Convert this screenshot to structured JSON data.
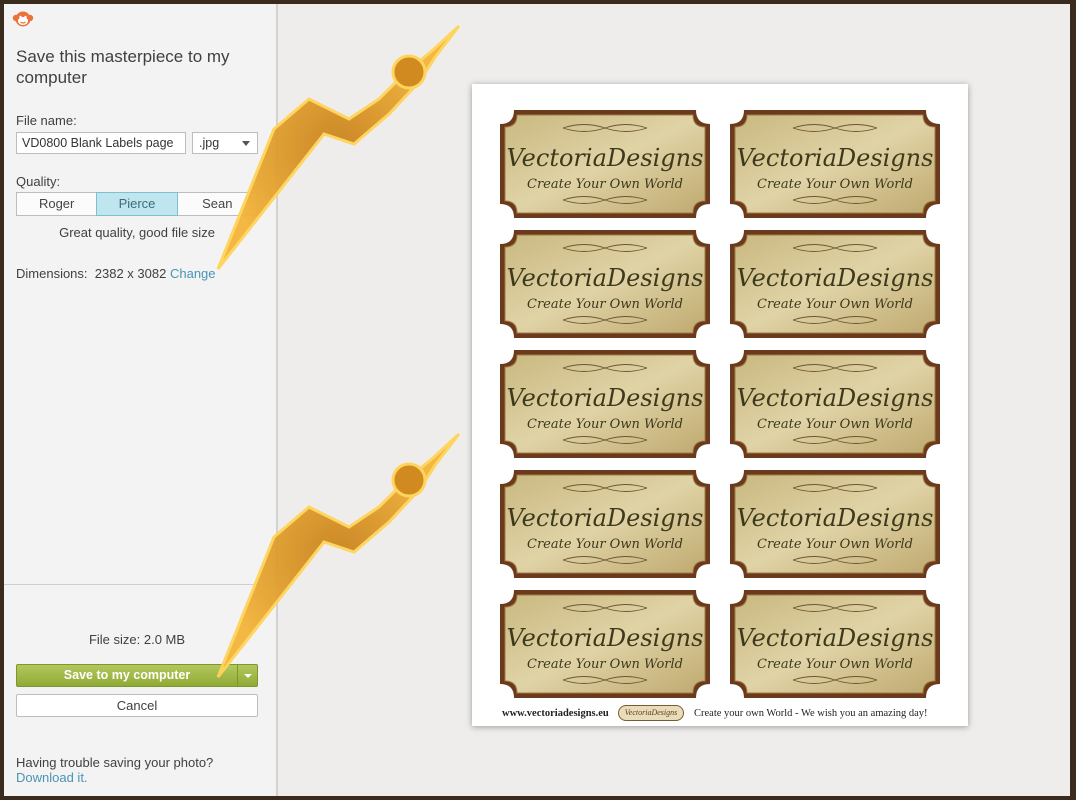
{
  "panel": {
    "title": "Save this masterpiece to my computer",
    "file_name_label": "File name:",
    "file_name_value": "VD0800 Blank Labels page",
    "format_value": ".jpg",
    "quality_label": "Quality:",
    "quality_options": [
      "Roger",
      "Pierce",
      "Sean"
    ],
    "quality_selected": "Pierce",
    "quality_description": "Great quality, good file size",
    "dimensions_label": "Dimensions:",
    "dimensions_value": "2382 x 3082",
    "change_link": "Change",
    "file_size": "File size: 2.0 MB",
    "save_button": "Save to my computer",
    "cancel_button": "Cancel",
    "trouble_text": "Having trouble saving your photo?",
    "download_link": "Download it."
  },
  "preview": {
    "label_brand": "VectoriaDesigns",
    "label_tagline": "Create Your Own World",
    "footer_url": "www.vectoriadesigns.eu",
    "footer_logo_text": "VectoriaDesigns",
    "footer_tagline": "Create your own World - We wish you an amazing day!"
  },
  "colors": {
    "accent_link": "#4a94b3",
    "save_green": "#9cb545",
    "selected_quality": "#bfe6ef",
    "frame_border": "#3b2a1e",
    "label_parchment": "#d8c99a",
    "label_border": "#6b3a1c"
  },
  "icons": {
    "app_logo": "monkey-face-icon",
    "format_dropdown": "chevron-down-icon",
    "save_dropdown": "chevron-down-icon"
  }
}
